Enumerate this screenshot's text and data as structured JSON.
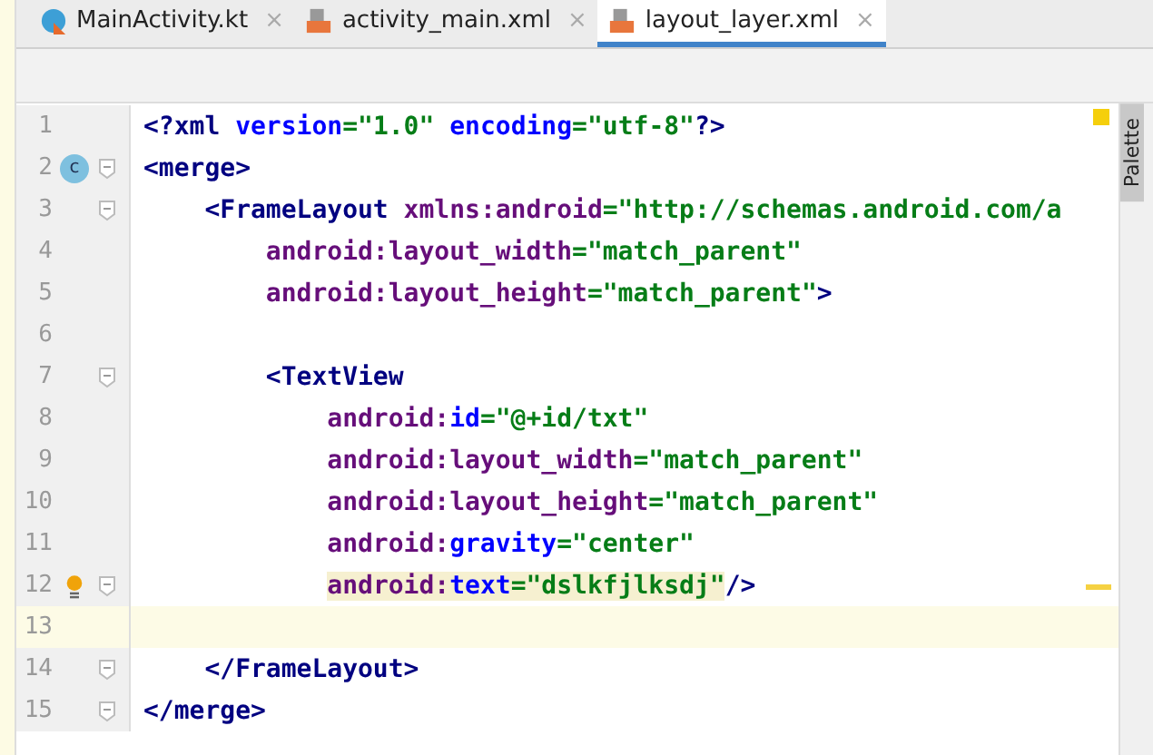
{
  "tabs": [
    {
      "label": "MainActivity.kt",
      "kind": "kotlin",
      "selected": false,
      "close": "×"
    },
    {
      "label": "activity_main.xml",
      "kind": "xml",
      "selected": false,
      "close": "×"
    },
    {
      "label": "layout_layer.xml",
      "kind": "xml",
      "selected": true,
      "close": "×"
    }
  ],
  "side_panel": {
    "label": "Palette"
  },
  "editor": {
    "lines": [
      {
        "number": "1",
        "fold": false,
        "current": false,
        "tokens": [
          {
            "t": "<?xml ",
            "kind": "tag"
          },
          {
            "t": "version",
            "kind": "attr"
          },
          {
            "t": "=\"1.0\" ",
            "kind": "val"
          },
          {
            "t": "encoding",
            "kind": "attr"
          },
          {
            "t": "=\"utf-8\"",
            "kind": "val"
          },
          {
            "t": "?>",
            "kind": "tag"
          }
        ]
      },
      {
        "number": "2",
        "fold": true,
        "current": false,
        "marker": {
          "kind": "class-badge",
          "text": "c"
        },
        "tokens": [
          {
            "t": "<merge>",
            "kind": "tag"
          }
        ]
      },
      {
        "number": "3",
        "fold": true,
        "current": false,
        "tokens": [
          {
            "t": "    <FrameLayout ",
            "kind": "tag"
          },
          {
            "t": "xmlns:android",
            "kind": "ns"
          },
          {
            "t": "=\"http://schemas.android.com/a",
            "kind": "val"
          }
        ]
      },
      {
        "number": "4",
        "fold": false,
        "current": false,
        "tokens": [
          {
            "t": "        android:layout_width",
            "kind": "ns"
          },
          {
            "t": "=\"match_parent\"",
            "kind": "val"
          }
        ]
      },
      {
        "number": "5",
        "fold": false,
        "current": false,
        "tokens": [
          {
            "t": "        android:layout_height",
            "kind": "ns"
          },
          {
            "t": "=\"match_parent\"",
            "kind": "val"
          },
          {
            "t": ">",
            "kind": "tag"
          }
        ]
      },
      {
        "number": "6",
        "fold": false,
        "current": false
      },
      {
        "number": "7",
        "fold": true,
        "current": false,
        "tokens": [
          {
            "t": "        <TextView",
            "kind": "tag"
          }
        ]
      },
      {
        "number": "8",
        "fold": false,
        "current": false,
        "tokens": [
          {
            "t": "            android:",
            "kind": "ns"
          },
          {
            "t": "id",
            "kind": "attr"
          },
          {
            "t": "=\"@+id/txt\"",
            "kind": "val"
          }
        ]
      },
      {
        "number": "9",
        "fold": false,
        "current": false,
        "tokens": [
          {
            "t": "            android:layout_width",
            "kind": "ns"
          },
          {
            "t": "=\"match_parent\"",
            "kind": "val"
          }
        ]
      },
      {
        "number": "10",
        "fold": false,
        "current": false,
        "tokens": [
          {
            "t": "            android:layout_height",
            "kind": "ns"
          },
          {
            "t": "=\"match_parent\"",
            "kind": "val"
          }
        ]
      },
      {
        "number": "11",
        "fold": false,
        "current": false,
        "tokens": [
          {
            "t": "            android:",
            "kind": "ns"
          },
          {
            "t": "gravity",
            "kind": "attr"
          },
          {
            "t": "=\"center\"",
            "kind": "val"
          }
        ]
      },
      {
        "number": "12",
        "fold": true,
        "current": false,
        "warning": true,
        "marker": {
          "kind": "bulb"
        },
        "tokens": [
          {
            "t": "            android:",
            "kind": "ns",
            "hl": true
          },
          {
            "t": "text",
            "kind": "attr",
            "hl": true
          },
          {
            "t": "=\"dslkfjlksdj\"",
            "kind": "val",
            "hl": true
          },
          {
            "t": "/>",
            "kind": "tag"
          }
        ]
      },
      {
        "number": "13",
        "fold": false,
        "current": true
      },
      {
        "number": "14",
        "fold": true,
        "current": false,
        "tokens": [
          {
            "t": "    </FrameLayout>",
            "kind": "tag"
          }
        ]
      },
      {
        "number": "15",
        "fold": true,
        "current": false,
        "tokens": [
          {
            "t": "</merge>",
            "kind": "tag"
          }
        ]
      }
    ]
  }
}
